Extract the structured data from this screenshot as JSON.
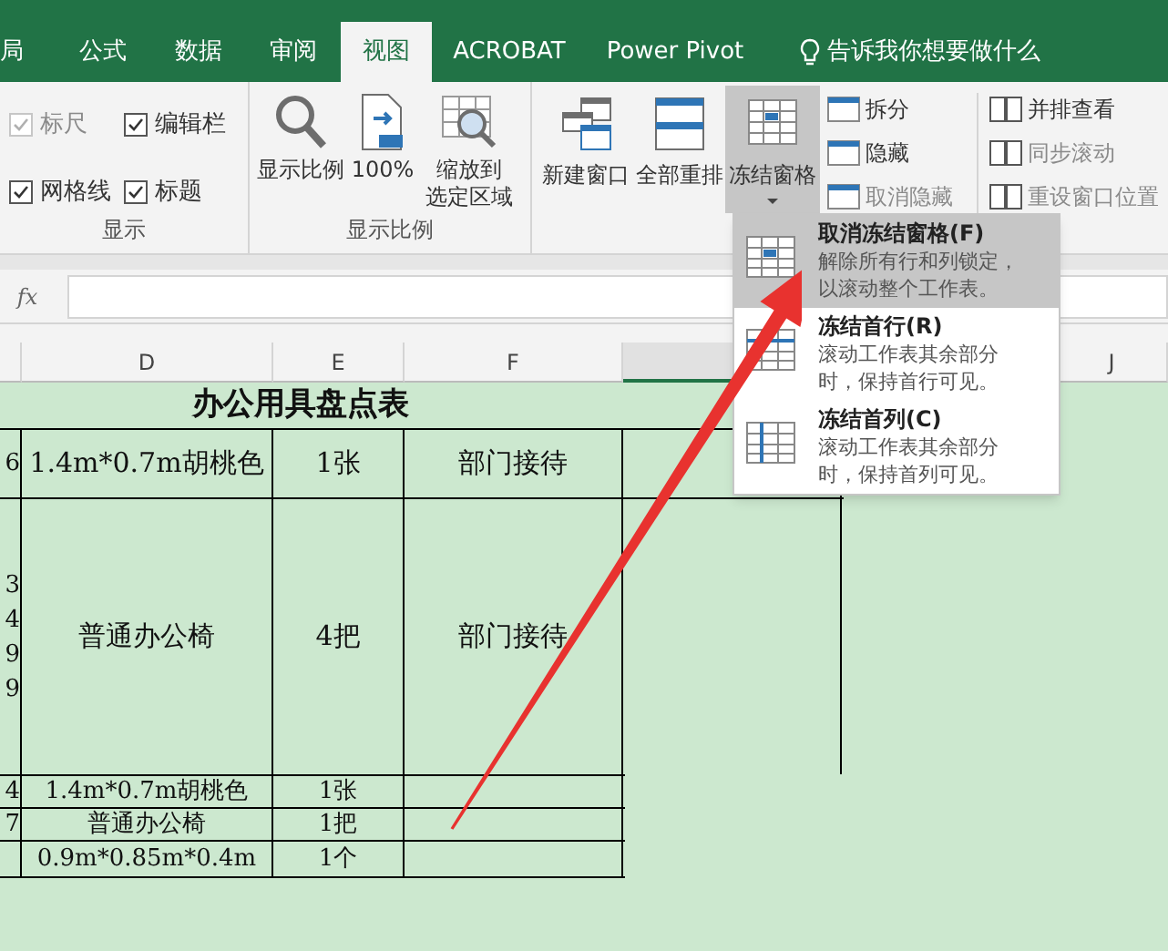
{
  "tabs": [
    {
      "label": "局",
      "selected": false
    },
    {
      "label": "公式",
      "selected": false
    },
    {
      "label": "数据",
      "selected": false
    },
    {
      "label": "审阅",
      "selected": false
    },
    {
      "label": "视图",
      "selected": true
    },
    {
      "label": "ACROBAT",
      "selected": false
    },
    {
      "label": "Power Pivot",
      "selected": false
    }
  ],
  "tell_me": "告诉我你想要做什么",
  "display_group": {
    "label": "显示",
    "checkboxes": [
      {
        "label": "标尺",
        "checked": true,
        "disabled": true
      },
      {
        "label": "编辑栏",
        "checked": true,
        "disabled": false
      },
      {
        "label": "网格线",
        "checked": true,
        "disabled": false
      },
      {
        "label": "标题",
        "checked": true,
        "disabled": false
      }
    ]
  },
  "zoom_group": {
    "label": "显示比例",
    "buttons": [
      {
        "lines": [
          "显示比例"
        ]
      },
      {
        "lines": [
          "100%"
        ]
      },
      {
        "lines": [
          "缩放到",
          "选定区域"
        ]
      }
    ]
  },
  "window_group": {
    "large_buttons": [
      {
        "label": "新建窗口",
        "pressed": false
      },
      {
        "label": "全部重排",
        "pressed": false
      },
      {
        "label": "冻结窗格",
        "pressed": true
      }
    ],
    "small_buttons": [
      {
        "label": "拆分",
        "disabled": false
      },
      {
        "label": "隐藏",
        "disabled": false
      },
      {
        "label": "取消隐藏",
        "disabled": true
      },
      {
        "label": "并排查看",
        "disabled": false
      },
      {
        "label": "同步滚动",
        "disabled": true
      },
      {
        "label": "重设窗口位置",
        "disabled": true
      }
    ]
  },
  "freeze_menu": [
    {
      "title": "取消冻结窗格(F)",
      "description": [
        "解除所有行和列锁定，",
        "以滚动整个工作表。"
      ],
      "selected": true
    },
    {
      "title": "冻结首行(R)",
      "description": [
        "滚动工作表其余部分",
        "时，保持首行可见。"
      ],
      "selected": false
    },
    {
      "title": "冻结首列(C)",
      "description": [
        "滚动工作表其余部分",
        "时，保持首列可见。"
      ],
      "selected": false
    }
  ],
  "formula_bar": {
    "function_label": "fx"
  },
  "columns": [
    {
      "selected": false
    },
    {
      "label": "D",
      "selected": false
    },
    {
      "label": "E",
      "selected": false
    },
    {
      "label": "F",
      "selected": false
    },
    {
      "selected": true
    },
    {
      "label": "J",
      "selected": false
    }
  ],
  "sheet_title": "办公用具盘点表",
  "rows": [
    {
      "cells": [
        "6",
        "1.4m*0.7m胡桃色",
        "1张",
        "部门接待"
      ]
    },
    {
      "cells": [
        "3\n4\n9\n9",
        "普通办公椅",
        "4把",
        "部门接待"
      ]
    },
    {
      "cells": [
        "4",
        "1.4m*0.7m胡桃色",
        "1张",
        ""
      ]
    },
    {
      "cells": [
        "7",
        "普通办公椅",
        "1把",
        ""
      ]
    },
    {
      "cells": [
        "",
        "0.9m*0.85m*0.4m",
        "1个",
        ""
      ]
    }
  ]
}
